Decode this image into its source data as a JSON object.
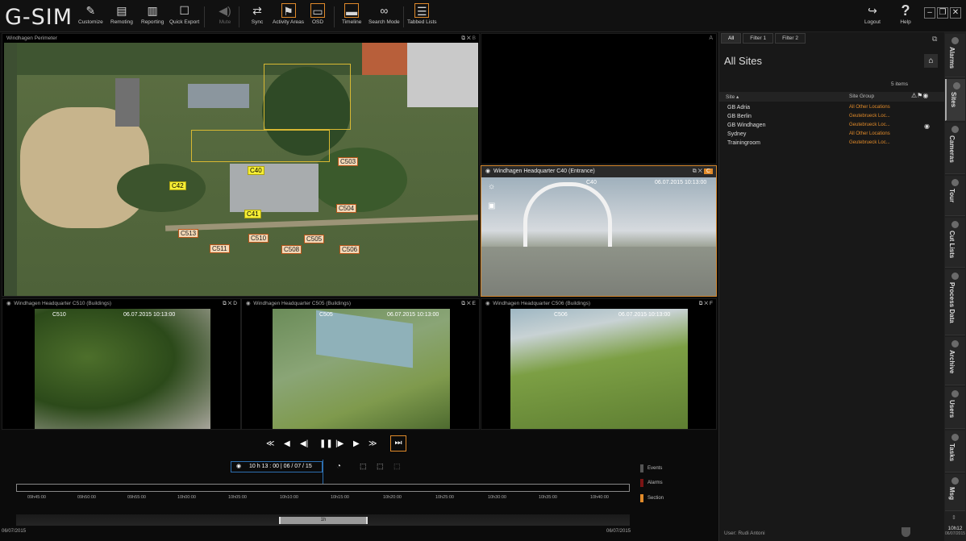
{
  "app": {
    "logo": "G-SIM"
  },
  "toolbar": [
    {
      "label": "Customize",
      "icon": "customize-icon"
    },
    {
      "label": "Remoting",
      "icon": "remoting-icon"
    },
    {
      "label": "Reporting",
      "icon": "reporting-icon"
    },
    {
      "label": "Quick Export",
      "icon": "export-icon"
    },
    {
      "label": "Mute",
      "icon": "speaker-icon",
      "disabled": true
    },
    {
      "label": "Sync",
      "icon": "sync-icon"
    },
    {
      "label": "Activity Areas",
      "icon": "activity-icon",
      "active": true
    },
    {
      "label": "OSD",
      "icon": "monitor-icon",
      "active": true
    },
    {
      "label": "Timeline",
      "icon": "timeline-icon",
      "active": true
    },
    {
      "label": "Search Mode",
      "icon": "binoculars-icon"
    },
    {
      "label": "Tabbed Lists",
      "icon": "lists-icon",
      "active": true
    }
  ],
  "toolbar_right": {
    "logout": "Logout",
    "help": "Help"
  },
  "panes": {
    "map": {
      "title": "Windhagen Perimeter",
      "letter": "B",
      "corner": "A"
    },
    "c": {
      "title": "Windhagen Headquarter C40 (Entrance)",
      "letter": "C",
      "osd": "06.07.2015 10:13:00",
      "cam": "C40"
    },
    "d": {
      "title": "Windhagen Headquarter C510 (Buildings)",
      "letter": "D",
      "osd": "06.07.2015 10:13:00",
      "cam": "C510"
    },
    "e": {
      "title": "Windhagen Headquarter C505 (Buildings)",
      "letter": "E",
      "osd": "06.07.2015 10:13:00",
      "cam": "C505"
    },
    "f": {
      "title": "Windhagen Headquarter C506 (Buildings)",
      "letter": "F",
      "osd": "06.07.2015 10:13:00",
      "cam": "C506"
    }
  },
  "map_labels": [
    "C40",
    "C42",
    "C41",
    "C503",
    "C504",
    "C513",
    "C511",
    "C510",
    "C505",
    "C508",
    "C506"
  ],
  "sites_panel": {
    "tabs": [
      "All",
      "Filter 1",
      "Filter 2"
    ],
    "title": "All Sites",
    "count": "5 items",
    "col_site": "Site ▴",
    "col_group": "Site Group",
    "rows": [
      {
        "site": "GB Adria",
        "group": "All Other Locations"
      },
      {
        "site": "GB Berlin",
        "group": "Geutebrueck Loc..."
      },
      {
        "site": "GB Windhagen",
        "group": "Geutebrueck Loc...",
        "eye": true
      },
      {
        "site": "Sydney",
        "group": "All Other Locations"
      },
      {
        "site": "Trainingroom",
        "group": "Geutebrueck Loc..."
      }
    ],
    "user": "User: Rudi Antoni"
  },
  "side_tabs": [
    "Alarms",
    "Sites",
    "Cameras",
    "Tour",
    "Cut Lists",
    "Process Data",
    "Archive",
    "Users",
    "Tasks",
    "Msg"
  ],
  "playback": {
    "time": "10 h 13 : 00 | 06 / 07 / 15",
    "ticks": [
      "09h45:00",
      "09h50:00",
      "09h55:00",
      "10h00:00",
      "10h05:00",
      "10h10:00",
      "10h15:00",
      "10h20:00",
      "10h25:00",
      "10h30:00",
      "10h35:00",
      "10h40:00"
    ],
    "legend": [
      {
        "label": "Events",
        "color": "#555555"
      },
      {
        "label": "Alarms",
        "color": "#7a1414"
      },
      {
        "label": "Section",
        "color": "#e08a2a"
      }
    ],
    "range": "1h",
    "date_left": "06/07/2015",
    "date_right": "06/07/2015"
  },
  "clock": {
    "time": "10h12",
    "date": "06/07/2015"
  }
}
